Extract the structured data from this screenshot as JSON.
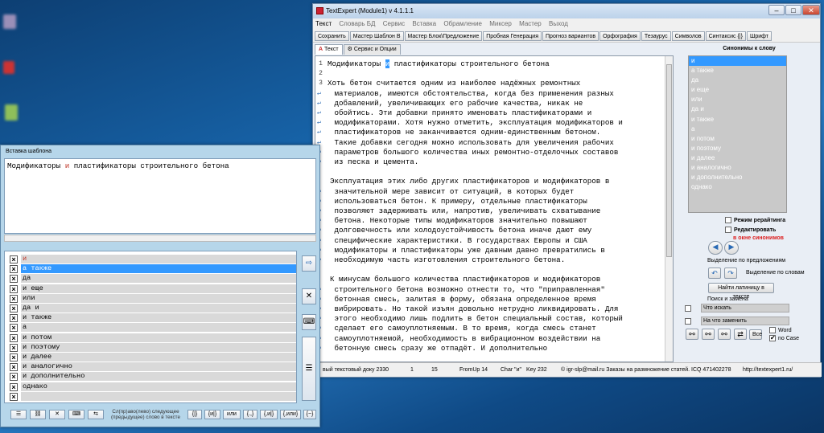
{
  "main_window": {
    "title": "TextExpert (Module1) v 4.1.1.1",
    "menu": [
      "Текст",
      "Словарь БД",
      "Сервис",
      "Вставка",
      "Обрамление",
      "Миксер",
      "Мастер",
      "Выход"
    ],
    "toolbar": [
      "Сохранить",
      "Мастер Шаблон B",
      "Мастер Блок\\Предложение",
      "Пробная Генерация",
      "Прогноз вариантов",
      "Орфография",
      "Тезаурус",
      "Символов",
      "Синтаксис {|}",
      "Шрифт"
    ],
    "tabs": [
      "Текст",
      "Сервис и Опции"
    ],
    "editor_lines": [
      {
        "n": "1",
        "text": "Модификаторы ",
        "hl": "и",
        "after": " пластификаторы строительного бетона"
      },
      {
        "n": "2",
        "text": ""
      },
      {
        "n": "3",
        "text": "Хоть бетон считается одним из наиболее надёжных ремонтных"
      },
      {
        "n": "",
        "text": " материалов, имеются обстоятельства, когда без применения разных"
      },
      {
        "n": "",
        "text": " добавлений, увеличивающих его рабочие качества, никак не"
      },
      {
        "n": "",
        "text": " обойтись. Эти добавки принято именовать пластификаторами и"
      },
      {
        "n": "",
        "text": " модификаторами. Хотя нужно отметить, эксплуатация модификаторов и"
      },
      {
        "n": "",
        "text": " пластификаторов не заканчивается одним-единственным бетоном."
      },
      {
        "n": "",
        "text": " Такие добавки сегодня можно использовать для увеличения рабочих"
      },
      {
        "n": "",
        "text": " параметров большого количества иных ремонтно-отделочных составов"
      },
      {
        "n": "",
        "text": " из песка и цемента."
      },
      {
        "n": "",
        "text": ""
      },
      {
        "n": "",
        "text": "Эксплуатация этих либо других пластификаторов и модификаторов в"
      },
      {
        "n": "",
        "text": " значительной мере зависит от ситуаций, в которых будет"
      },
      {
        "n": "",
        "text": " использоваться бетон. К примеру, отдельные пластификаторы"
      },
      {
        "n": "",
        "text": " позволяют задерживать или, напротив, увеличивать схватывание"
      },
      {
        "n": "",
        "text": " бетона. Некоторые типы модификаторов значительно повышают"
      },
      {
        "n": "",
        "text": " долговечность или холодоустойчивость бетона иначе дают ему"
      },
      {
        "n": "",
        "text": " специфические характеристики. В государствах Европы и США"
      },
      {
        "n": "",
        "text": " модификаторы и пластификаторы уже давным давно превратились в"
      },
      {
        "n": "",
        "text": " необходимую часть изготовления строительного бетона."
      },
      {
        "n": "",
        "text": ""
      },
      {
        "n": "",
        "text": "К минусам большого количества пластификаторов и модификаторов"
      },
      {
        "n": "",
        "text": " строительного бетона возможно отнести то, что \"приправленная\""
      },
      {
        "n": "",
        "text": " бетонная смесь, залитая в форму, обязана определенное время"
      },
      {
        "n": "",
        "text": " вибрировать. Но такой изъян довольно нетрудно ликвидировать. Для"
      },
      {
        "n": "",
        "text": " этого необходимо лишь подлить в бетон специальный состав, который"
      },
      {
        "n": "",
        "text": " сделает его самоуплотняемым. В то время, когда смесь станет"
      },
      {
        "n": "",
        "text": " самоуплотняемой, необходимость в вибрационном воздействии на"
      },
      {
        "n": "",
        "text": " бетонную смесь сразу же отпадёт. И дополнительно"
      }
    ],
    "status": {
      "doc": "вый текстовый доку 2330",
      "n1": "1",
      "n2": "15",
      "fromup": "FromUp 14",
      "char": "Char \"и\"",
      "key": "Key 232",
      "contact": "© igr-slp@mail.ru Заказы на размножение статей. ICQ 471402278",
      "url": "http://textexpert1.ru/"
    },
    "right_panel": {
      "title": "Синонимы к слову",
      "synonyms": [
        "и",
        "а также",
        "да",
        "и еще",
        "или",
        "да и",
        "и также",
        "а",
        "и потом",
        "и поэтому",
        "и далее",
        "и аналогично",
        "и дополнительно",
        "однако"
      ],
      "mode_rewrite": "Режим рерайтинга",
      "edit": "Редактировать",
      "in_window": "в окне синонимов",
      "sel_sentence": "Выделение по предложениям",
      "sel_words": "Выделение по словам",
      "find_latin": "Найти латиницу в тексте",
      "search_replace": "Поиск и замена",
      "find_what": "Что искать",
      "replace_with": "На что заменить",
      "all": "Все",
      "word": "Word",
      "no_case": "no Case"
    }
  },
  "template_window": {
    "title": "Вставка шаблона",
    "text_before": "Модификаторы ",
    "text_red": "и",
    "text_after": " пластификаторы строительного бетона",
    "list": [
      "и",
      "а также",
      "да",
      "и еще",
      "или",
      "да и",
      "и также",
      "а",
      "и потом",
      "и поэтому",
      "и далее",
      "и аналогично",
      "и дополнительно",
      "однако",
      ""
    ],
    "hint1": "Сл(пр)аво(лево) следующее",
    "hint2": "(предыдущее) слово в тексте",
    "buttons": [
      "{|}",
      "{и|}",
      "или",
      "{.,}",
      "{,и|}",
      "{,или}",
      "{~}"
    ]
  },
  "desktop": {
    "bg": "#1763a8",
    "accent": "#3399ff"
  }
}
